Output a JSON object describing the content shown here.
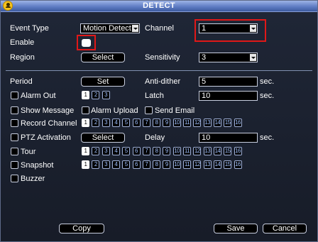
{
  "window": {
    "title": "DETECT"
  },
  "top": {
    "event_type_label": "Event Type",
    "event_type_value": "Motion Detect",
    "channel_label": "Channel",
    "channel_value": "1",
    "enable_label": "Enable",
    "region_label": "Region",
    "region_button": "Select",
    "sensitivity_label": "Sensitivity",
    "sensitivity_value": "3"
  },
  "settings": {
    "period_label": "Period",
    "period_button": "Set",
    "anti_dither_label": "Anti-dither",
    "anti_dither_value": "5",
    "anti_dither_unit": "sec.",
    "alarm_out_label": "Alarm Out",
    "alarm_out_numbers": [
      "1",
      "2",
      "3"
    ],
    "latch_label": "Latch",
    "latch_value": "10",
    "latch_unit": "sec.",
    "show_message_label": "Show Message",
    "alarm_upload_label": "Alarm Upload",
    "send_email_label": "Send Email",
    "record_channel_label": "Record Channel",
    "ptz_activation_label": "PTZ Activation",
    "ptz_button": "Select",
    "delay_label": "Delay",
    "delay_value": "10",
    "delay_unit": "sec.",
    "tour_label": "Tour",
    "snapshot_label": "Snapshot",
    "buzzer_label": "Buzzer",
    "channel_numbers": [
      "1",
      "2",
      "3",
      "4",
      "5",
      "6",
      "7",
      "8",
      "9",
      "10",
      "11",
      "12",
      "13",
      "14",
      "15",
      "16"
    ]
  },
  "footer": {
    "copy_button": "Copy",
    "save_button": "Save",
    "cancel_button": "Cancel"
  },
  "colors": {
    "accent": "#e01818",
    "title_bar": "#5f7dc4",
    "background": "#171c28"
  }
}
